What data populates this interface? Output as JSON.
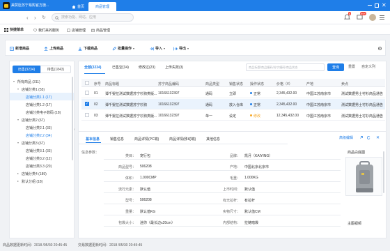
{
  "titlebar": {
    "store_name": "美赞臣苏宁易购官方旗...",
    "tab_home": "首页",
    "tab_active": "商品管理",
    "colors": {
      "bar": "#1f7ee8",
      "active_tab": "#ffffff"
    }
  },
  "addressbar": {
    "search_placeholder": "搜索功能、网站、应用",
    "badge_count_1": "6",
    "badge_count_2": "99+"
  },
  "menubar": {
    "shortcut_label": "快捷菜单",
    "items": [
      {
        "label": "我们来的服务",
        "icon": "heart-icon"
      },
      {
        "label": "店铺管理",
        "icon": "doc-icon"
      },
      {
        "label": "商品管理",
        "icon": "box-icon"
      }
    ]
  },
  "toolbar": {
    "buttons": [
      {
        "label": "新增商品",
        "icon": "edit-icon"
      },
      {
        "label": "上传商品",
        "icon": "upload-icon"
      },
      {
        "label": "下载商品",
        "icon": "download-icon"
      },
      {
        "label": "批量操作",
        "icon": "pencil-icon"
      },
      {
        "label": "导入",
        "icon": "import-icon"
      },
      {
        "label": "导出",
        "icon": "export-icon"
      }
    ],
    "gear_label": ""
  },
  "left_panel": {
    "tab_sale": "出售(3234)",
    "tab_stock": "待售(1843)",
    "tree": [
      {
        "label": "所有商品 (311)",
        "level": 0,
        "expanded": true
      },
      {
        "label": "店铺分类1 (55)",
        "level": 1,
        "expanded": true
      },
      {
        "label": "店铺分类1.1 (17)",
        "level": 2,
        "selected": true
      },
      {
        "label": "店铺分类1.2 (17)",
        "level": 2
      },
      {
        "label": "店铺分类电子数码 (18)",
        "level": 2
      },
      {
        "label": "店铺分类2 (67)",
        "level": 1,
        "expanded": true
      },
      {
        "label": "店铺分类2.1 (33)",
        "level": 2
      },
      {
        "label": "店铺分类2.2 (34)",
        "level": 2,
        "blue": true
      },
      {
        "label": "店铺分类3 (67)",
        "level": 1,
        "expanded": true
      },
      {
        "label": "店铺分类3.1 (33)",
        "level": 2
      },
      {
        "label": "店铺分类3.2 (12)",
        "level": 2
      },
      {
        "label": "店铺分类3.3 (20)",
        "level": 2
      },
      {
        "label": "店铺分类4 (189)",
        "level": 1,
        "expanded": false
      },
      {
        "label": "默认分组 (18)",
        "level": 1,
        "expanded": false
      }
    ]
  },
  "main": {
    "tabs": [
      {
        "label": "全部(3234)",
        "active": true
      },
      {
        "label": "已售空(34)"
      },
      {
        "label": "修改过(23)"
      },
      {
        "label": "上传失败(3)"
      }
    ],
    "search_placeholder": "商品标题/商品编码/苏宁编码/商品状态",
    "query_btn": "查询",
    "reset_btn": "重置",
    "custom_cols_btn": "自定义列",
    "table": {
      "headers": [
        "序号",
        "商品标题",
        "苏宁商品编码",
        "商品类型",
        "销售状态",
        "操作状态",
        "价格（¥）",
        "产地",
        "卖点"
      ],
      "rows": [
        {
          "checked": false,
          "cells": [
            "01",
            "谭千婴拉测试数据苏宁杉狗类版...",
            "10166132397",
            "通码",
            "立即",
            "正常",
            "2,345,432.00",
            "中国江苏南京市",
            "测试数据男士衬衫商品通告"
          ]
        },
        {
          "checked": true,
          "cells": [
            "02",
            "谭千婴拉测试数据苏宁杉狗",
            "10166132397",
            "通码",
            "放入仓库",
            "正常",
            "2,345,432.00",
            "中国江苏南京市",
            "测试数据男士衬衫商品通告"
          ]
        },
        {
          "checked": false,
          "cells": [
            "03",
            "谭千婴拉测试数据苏宁杉狗类版...",
            "10166132397",
            "单一",
            "设定",
            "修改",
            "12,345,432.00",
            "中国江苏南京市",
            "测试数据男士衬衫商品通告"
          ]
        }
      ]
    },
    "detail": {
      "tabs": [
        {
          "label": "基本信息",
          "active": true
        },
        {
          "label": "销售信息"
        },
        {
          "label": "商品详情(PC端)"
        },
        {
          "label": "商品详情(移动端)"
        },
        {
          "label": "其他信息"
        }
      ],
      "advanced_edit": "高级编辑",
      "section_label": "信息参数：",
      "fields": [
        [
          "类目",
          "宠行包",
          "品牌",
          "凯月（KAIYING）"
        ],
        [
          "商品型号",
          "506208",
          "产地",
          "中国北京北京市"
        ],
        [
          "体积",
          "1.000CMP",
          "毛重",
          "1.000KG"
        ],
        [
          "流行元素",
          "默认值",
          "上市时间",
          "默认值"
        ],
        [
          "型号",
          "506208",
          "有无拉杆",
          "有拉杆"
        ],
        [
          "重量",
          "默认值KG",
          "实物尺寸",
          "默认值CM"
        ],
        [
          "包袋大小",
          "迷你（最长边≤20cm）",
          "内部结构",
          "拉链暗袋"
        ]
      ],
      "image_title": "商品白底图",
      "main_image_title": "主图视频"
    }
  },
  "statusbar": {
    "product_update": "商品数据更新时间：2018 /05/30   20:45:45",
    "trade_update": "交易数据更新时间：2018 /05/30   20:45:45"
  }
}
